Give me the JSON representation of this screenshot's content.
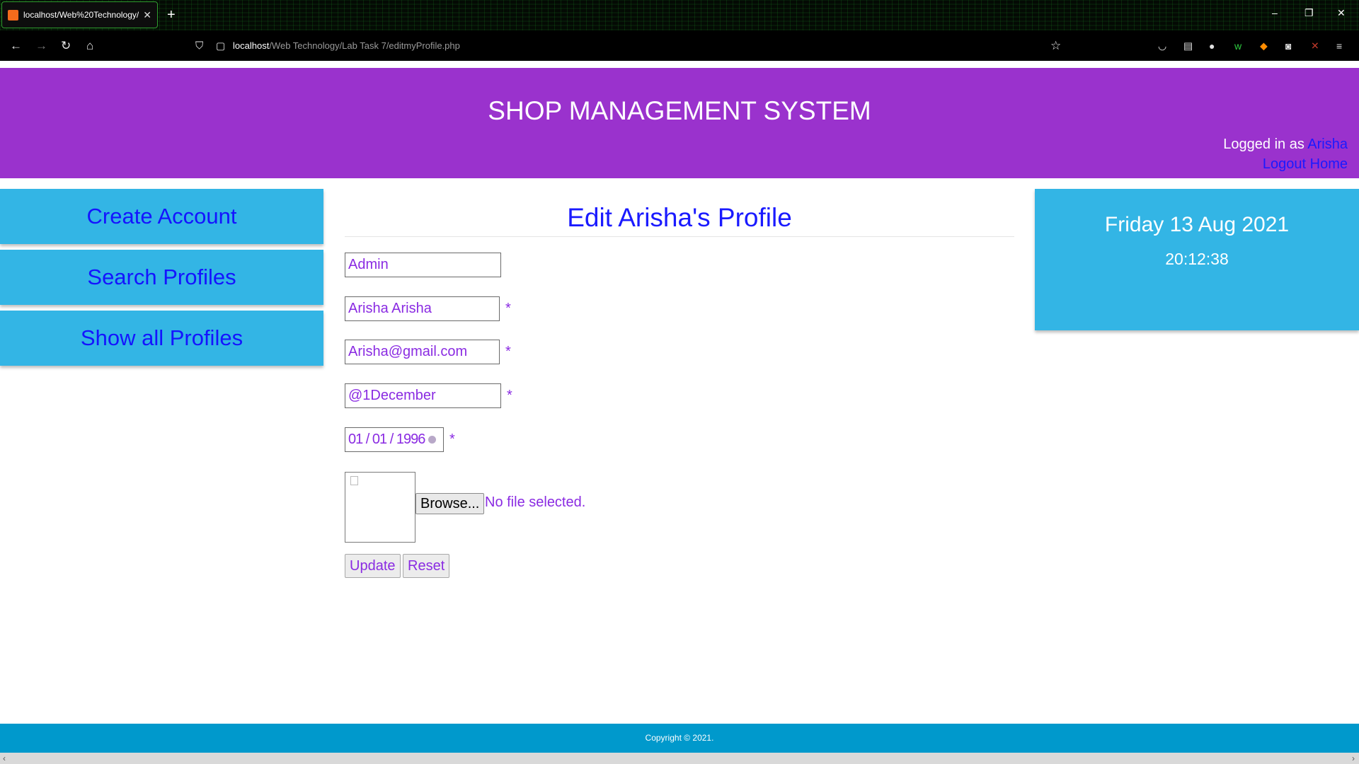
{
  "browser": {
    "tab_title": "localhost/Web%20Technology/",
    "tab_close": "✕",
    "new_tab": "+",
    "url_host": "localhost",
    "url_path": "/Web Technology/Lab Task 7/editmyProfile.php",
    "window_controls": [
      "–",
      "❐",
      "✕"
    ]
  },
  "header": {
    "title": "SHOP MANAGEMENT SYSTEM",
    "logged_in_prefix": "Logged in as",
    "username": "Arisha",
    "logout_link": "Logout",
    "home_link": "Home"
  },
  "sidebar": {
    "items": [
      {
        "label": "Create Account"
      },
      {
        "label": "Search Profiles"
      },
      {
        "label": "Show all Profiles"
      }
    ]
  },
  "form": {
    "title": "Edit Arisha's Profile",
    "role_value": "Admin",
    "name_value": "Arisha Arisha",
    "email_value": "Arisha@gmail.com",
    "password_value": "@1December",
    "dob_value": "01 / 01 / 1996",
    "required_mark": "*",
    "browse_label": "Browse...",
    "file_status": "No file selected.",
    "update_label": "Update",
    "reset_label": "Reset"
  },
  "datetime": {
    "date": "Friday 13 Aug 2021",
    "time": "20:12:38"
  },
  "footer": {
    "copyright": "Copyright © 2021."
  },
  "colors": {
    "header_bg": "#9a32cd",
    "nav_bg": "#33b5e5",
    "link": "#1a1aff",
    "input_text": "#8a2be2",
    "footer_bg": "#0099cc"
  }
}
